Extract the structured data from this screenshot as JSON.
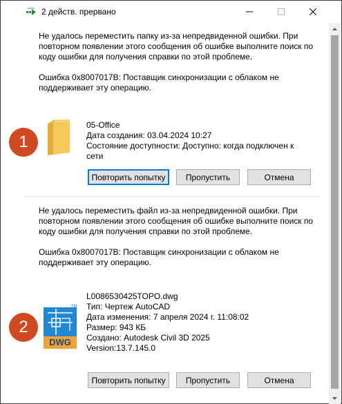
{
  "window": {
    "title": "2 действ. прервано",
    "controls": {
      "minimize": "minimize",
      "maximize": "maximize",
      "close": "close"
    }
  },
  "errors": [
    {
      "badge": "1",
      "message": "Не удалось переместить папку из-за непредвиденной ошибки. При повторном появлении этого сообщения об ошибке выполните поиск по коду ошибки для получения справки по этой проблеме.",
      "code": "Ошибка 0x8007017B: Поставщик синхронизации с облаком не поддерживает эту операцию.",
      "item": {
        "icon": "folder-icon",
        "lines": [
          "05-Office",
          "Дата создания: 03.04.2024 10:27",
          "Состояние доступности: Доступно: когда подключен к сети"
        ]
      },
      "buttons": {
        "retry": "Повторить попытку",
        "skip": "Пропустить",
        "cancel": "Отмена"
      }
    },
    {
      "badge": "2",
      "message": "Не удалось переместить файл из-за непредвиденной ошибки. При повторном появлении этого сообщения об ошибке выполните поиск по коду ошибки для получения справки по этой проблеме.",
      "code": "Ошибка 0x8007017B: Поставщик синхронизации с облаком не поддерживает эту операцию.",
      "item": {
        "icon": "dwg-file-icon",
        "icon_label": "DWG",
        "icon_tm": "TM",
        "lines": [
          "L0086530425TOPO.dwg",
          "Тип: Чертеж AutoCAD",
          "Дата изменения: 7 апреля 2024 г. 11:08:02",
          "Размер: 943 КБ",
          "Создано: Autodesk Civil 3D 2025",
          "Version:13.7.145.0"
        ]
      },
      "buttons": {
        "retry": "Повторить попытку",
        "skip": "Пропустить",
        "cancel": "Отмена"
      }
    }
  ],
  "colors": {
    "badge": "#cf4a22",
    "accent": "#0078d7",
    "button_bg": "#e1e1e1",
    "folder": "#f5c95a",
    "dwg_blue": "#1a78c2",
    "dwg_orange": "#f0a03a"
  }
}
